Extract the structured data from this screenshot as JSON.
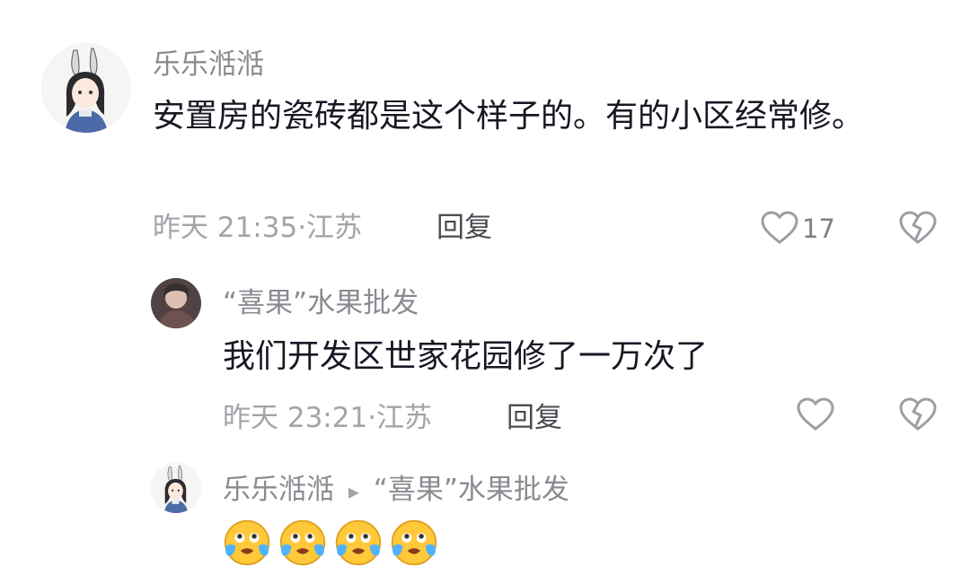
{
  "comment": {
    "username": "乐乐湉湉",
    "text": "安置房的瓷砖都是这个样子的。有的小区经常修。",
    "time": "昨天 21:35·",
    "location": "江苏",
    "reply_label": "回复",
    "like_count": "17",
    "like_icon": "heart-outline",
    "dislike_icon": "broken-heart"
  },
  "reply1": {
    "username": "“喜果”水果批发",
    "text": "我们开发区世家花园修了一万次了",
    "time": "昨天 23:21·",
    "location": "江苏",
    "reply_label": "回复",
    "like_icon": "heart-outline",
    "dislike_icon": "broken-heart"
  },
  "reply2": {
    "username": "乐乐湉湉",
    "separator": "▸",
    "reply_to": "“喜果”水果批发",
    "emoji_name": "crying-tears-of-joy",
    "emoji_count": 4
  },
  "colors": {
    "username": "#8a8b91",
    "text": "#161823",
    "meta": "#a3a4aa",
    "icon": "#9d9ea4",
    "emoji": "#ffc93a"
  }
}
